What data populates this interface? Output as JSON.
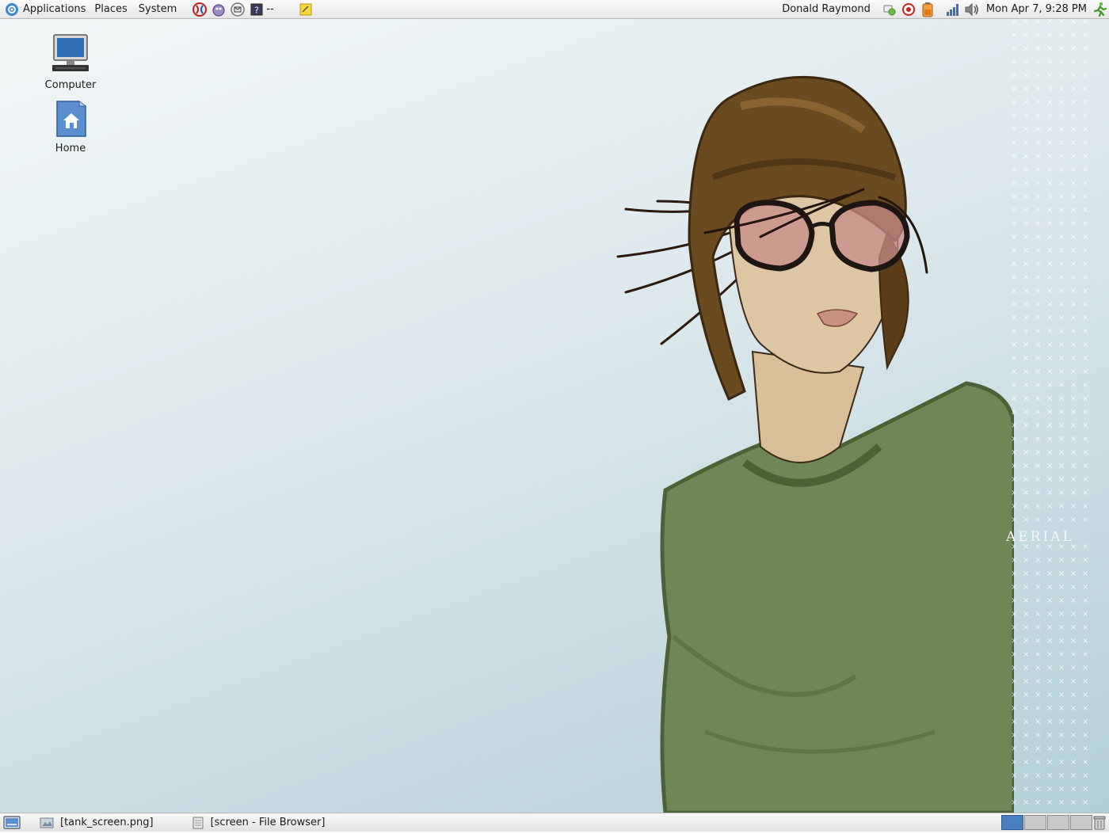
{
  "top_panel": {
    "menus": {
      "applications": "Applications",
      "places": "Places",
      "system": "System"
    },
    "launchers": [
      "globe-launcher-icon",
      "messenger-launcher-icon",
      "mail-launcher-icon",
      "help-launcher-icon"
    ],
    "help_suffix": "--",
    "user_name": "Donald Raymond",
    "clock": "Mon Apr  7,  9:28 PM",
    "tray": [
      "network-status-icon",
      "notification-icon",
      "battery-icon",
      "signal-icon",
      "volume-icon"
    ]
  },
  "desktop": {
    "icons": [
      {
        "label": "Computer",
        "icon": "computer-icon"
      },
      {
        "label": "Home",
        "icon": "home-folder-icon"
      }
    ],
    "wallpaper_text": "AERIAL"
  },
  "bottom_panel": {
    "tasks": [
      {
        "label": "[tank_screen.png]"
      },
      {
        "label": "[screen - File Browser]"
      }
    ],
    "workspaces": 4,
    "active_workspace": 1
  },
  "colors": {
    "panel": "#eeeeee",
    "desktop_light": "#f3f7f8",
    "desktop_dark": "#b3ced6",
    "workspace_active": "#4a7fc0",
    "shirt": "#6f8656",
    "helmet": "#6a4a1f"
  }
}
